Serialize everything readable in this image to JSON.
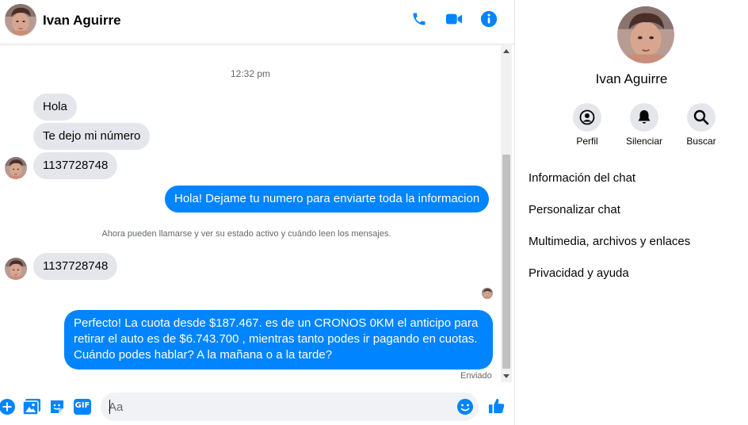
{
  "header": {
    "contact_name": "Ivan Aguirre",
    "icons": [
      "phone-icon",
      "video-camera-icon",
      "info-icon"
    ]
  },
  "conversation": {
    "timestamp": "12:32 pm",
    "incoming_1": "Hola",
    "incoming_2": "Te dejo mi número",
    "incoming_3": "1137728748",
    "outgoing_1": "Hola! Dejame tu numero  para enviarte toda la informacion",
    "system_notice": "Ahora pueden llamarse y ver su estado activo y cuándo leen los mensajes.",
    "incoming_4": "1137728748",
    "outgoing_2_line1": "Perfecto! La cuota desde $187.467. es de un CRONOS 0KM el anticipo para",
    "outgoing_2_line2": "retirar el auto es de $6.743.700 , mientras tanto podes ir pagando en cuotas.",
    "outgoing_2_line3": "Cuándo podes hablar? A la mañana o a la tarde?",
    "sent_status": "Enviado"
  },
  "composer": {
    "placeholder": "Aa",
    "value": "",
    "icons": [
      "plus-icon",
      "image-icon",
      "sticker-icon",
      "gif-icon",
      "emoji-icon",
      "thumbs-up-icon"
    ],
    "gif_label": "GIF"
  },
  "info_panel": {
    "name": "Ivan Aguirre",
    "actions": [
      {
        "label": "Perfil",
        "icon": "profile-icon"
      },
      {
        "label": "Silenciar",
        "icon": "bell-icon"
      },
      {
        "label": "Buscar",
        "icon": "search-icon"
      }
    ],
    "menu": [
      "Información del chat",
      "Personalizar chat",
      "Multimedia, archivos y enlaces",
      "Privacidad y ayuda"
    ]
  },
  "colors": {
    "accent": "#0084ff",
    "incoming_bubble": "#e4e6eb",
    "secondary_text": "#65676b"
  }
}
